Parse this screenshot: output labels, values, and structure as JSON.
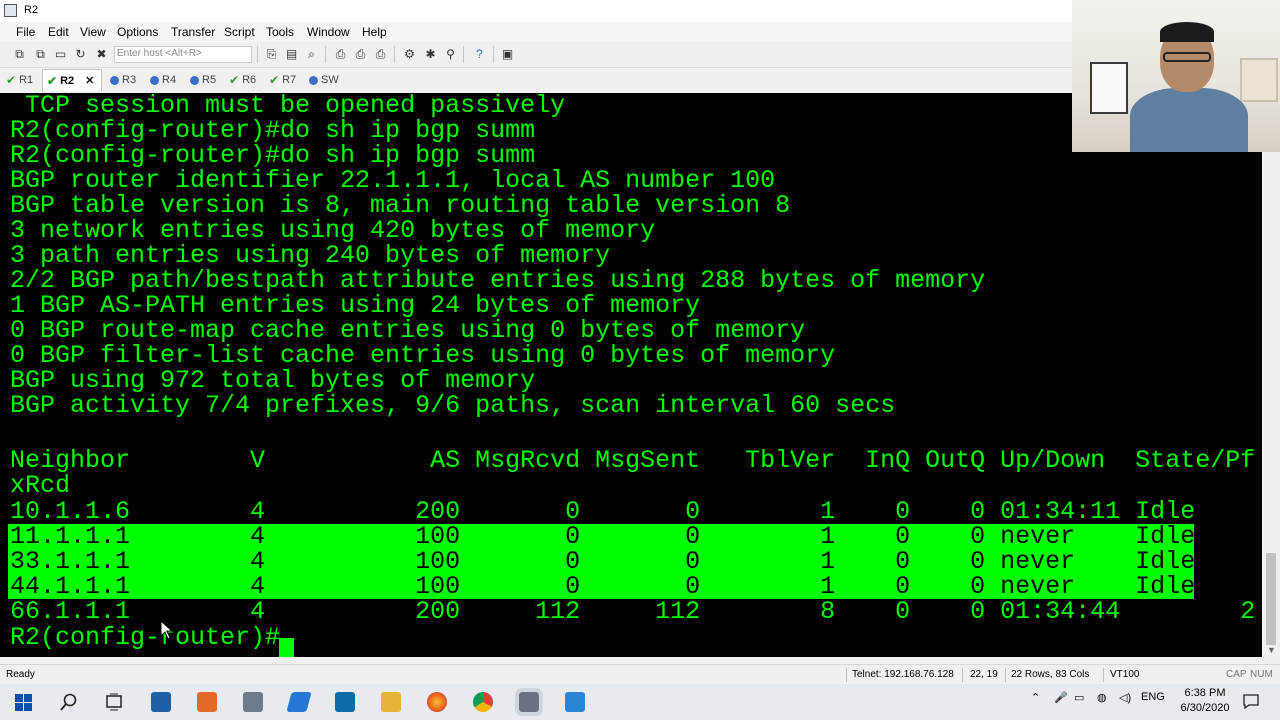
{
  "window": {
    "title": "R2"
  },
  "menu": [
    "File",
    "Edit",
    "View",
    "Options",
    "Transfer",
    "Script",
    "Tools",
    "Window",
    "Help"
  ],
  "toolbar": {
    "host_placeholder": "Enter host <Alt+R>"
  },
  "tabs": [
    {
      "label": "R1",
      "state": "connected"
    },
    {
      "label": "R2",
      "state": "connected",
      "active": true
    },
    {
      "label": "R3",
      "state": "info"
    },
    {
      "label": "R4",
      "state": "info"
    },
    {
      "label": "R5",
      "state": "info"
    },
    {
      "label": "R6",
      "state": "connected"
    },
    {
      "label": "R7",
      "state": "connected"
    },
    {
      "label": "SW",
      "state": "info"
    }
  ],
  "terminal": {
    "lines": [
      " TCP session must be opened passively",
      "R2(config-router)#do sh ip bgp summ",
      "R2(config-router)#do sh ip bgp summ",
      "BGP router identifier 22.1.1.1, local AS number 100",
      "BGP table version is 8, main routing table version 8",
      "3 network entries using 420 bytes of memory",
      "3 path entries using 240 bytes of memory",
      "2/2 BGP path/bestpath attribute entries using 288 bytes of memory",
      "1 BGP AS-PATH entries using 24 bytes of memory",
      "0 BGP route-map cache entries using 0 bytes of memory",
      "0 BGP filter-list cache entries using 0 bytes of memory",
      "BGP using 972 total bytes of memory",
      "BGP activity 7/4 prefixes, 9/6 paths, scan interval 60 secs",
      "",
      "Neighbor        V           AS MsgRcvd MsgSent   TblVer  InQ OutQ Up/Down  State/Pf",
      "xRcd",
      "10.1.1.6        4          200       0       0        1    0    0 01:34:11 Idle",
      "11.1.1.1        4          100       0       0        1    0    0 never    Idle",
      "33.1.1.1        4          100       0       0        1    0    0 never    Idle",
      "44.1.1.1        4          100       0       0        1    0    0 never    Idle",
      "66.1.1.1        4          200     112     112        8    0    0 01:34:44        2",
      "R2(config-router)#"
    ],
    "highlighted_rows": [
      17,
      18,
      19
    ]
  },
  "status": {
    "ready": "Ready",
    "connection": "Telnet: 192.168.76.128",
    "position": "22, 19",
    "size": "22 Rows, 83 Cols",
    "emulation": "VT100",
    "caps": "CAP",
    "num": "NUM"
  },
  "taskbar": {
    "language": "ENG",
    "time": "6:38 PM",
    "date": "6/30/2020"
  },
  "colors": {
    "terminal_fg": "#00ff00",
    "terminal_bg": "#000000",
    "highlight_bg": "#00ff00"
  }
}
